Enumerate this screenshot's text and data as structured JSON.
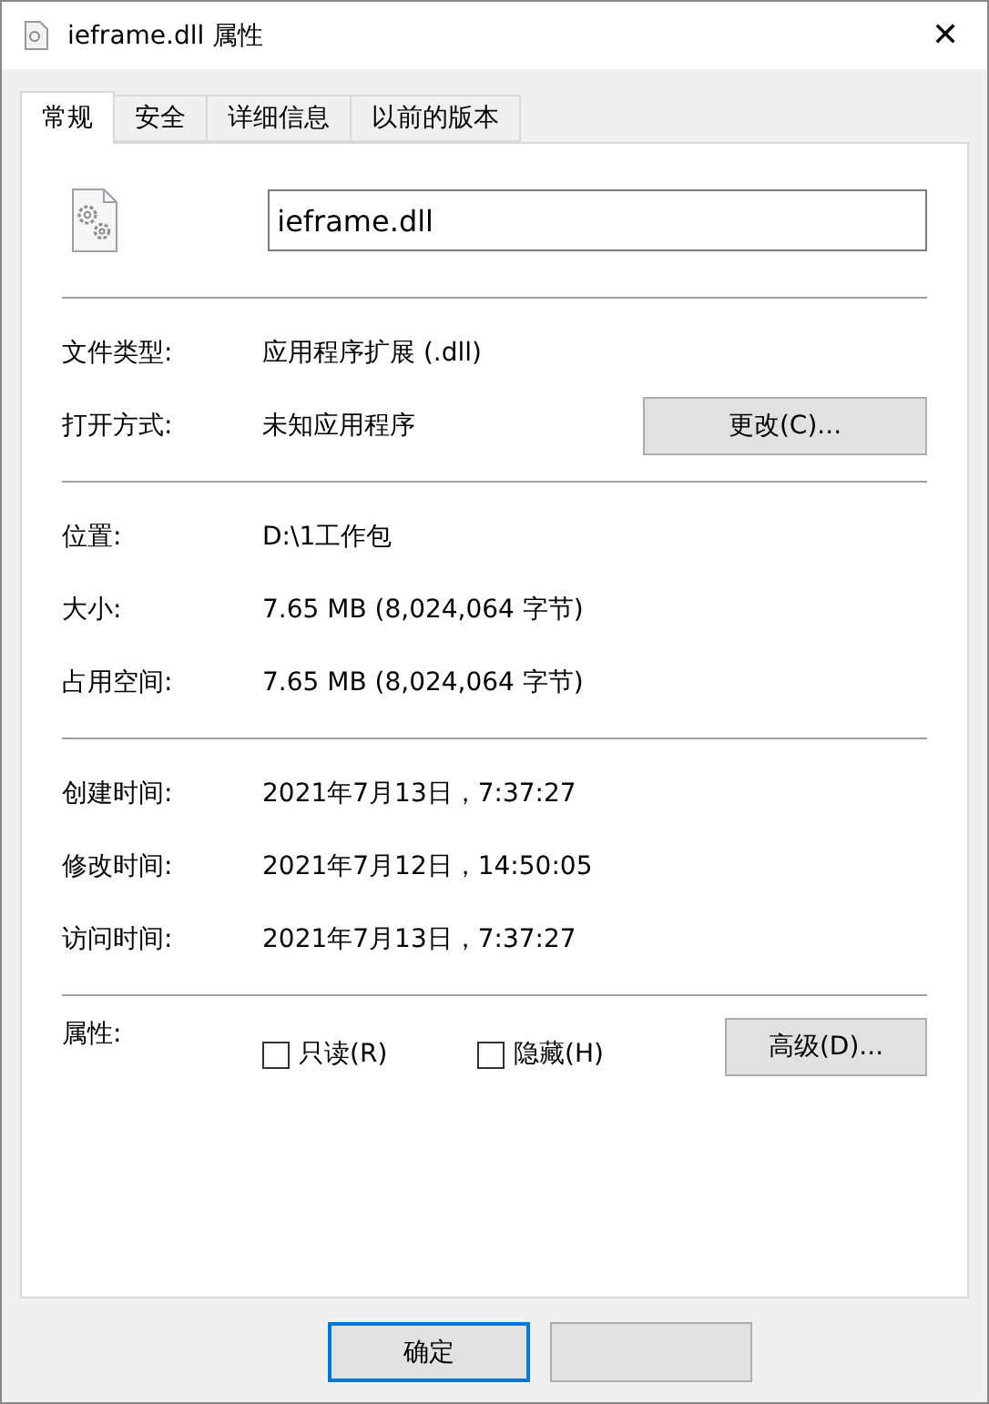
{
  "window": {
    "title": "ieframe.dll 属性",
    "close": "✕"
  },
  "tabs": [
    {
      "label": "常规",
      "selected": true
    },
    {
      "label": "安全",
      "selected": false
    },
    {
      "label": "详细信息",
      "selected": false
    },
    {
      "label": "以前的版本",
      "selected": false
    }
  ],
  "file_name": {
    "value": "ieframe.dll"
  },
  "sections": [
    {
      "rows": [
        {
          "label": "文件类型:",
          "value": "应用程序扩展 (.dll)"
        },
        {
          "label": "打开方式:",
          "value": "未知应用程序",
          "button": "更改(C)..."
        }
      ]
    },
    {
      "rows": [
        {
          "label": "位置:",
          "value": "D:\\1工作包"
        },
        {
          "label": "大小:",
          "value": "7.65 MB (8,024,064 字节)"
        },
        {
          "label": "占用空间:",
          "value": "7.65 MB (8,024,064 字节)"
        }
      ]
    },
    {
      "rows": [
        {
          "label": "创建时间:",
          "value": "2021年7月13日，7:37:27"
        },
        {
          "label": "修改时间:",
          "value": "2021年7月12日，14:50:05"
        },
        {
          "label": "访问时间:",
          "value": "2021年7月13日，7:37:27"
        }
      ]
    }
  ],
  "attributes": {
    "label": "属性:",
    "checkboxes": [
      {
        "label": "只读(R)",
        "checked": false
      },
      {
        "label": "隐藏(H)",
        "checked": false
      }
    ],
    "button": "高级(D)..."
  },
  "buttons": [
    {
      "label": "确定",
      "selected": true
    },
    {
      "selected": false
    }
  ]
}
